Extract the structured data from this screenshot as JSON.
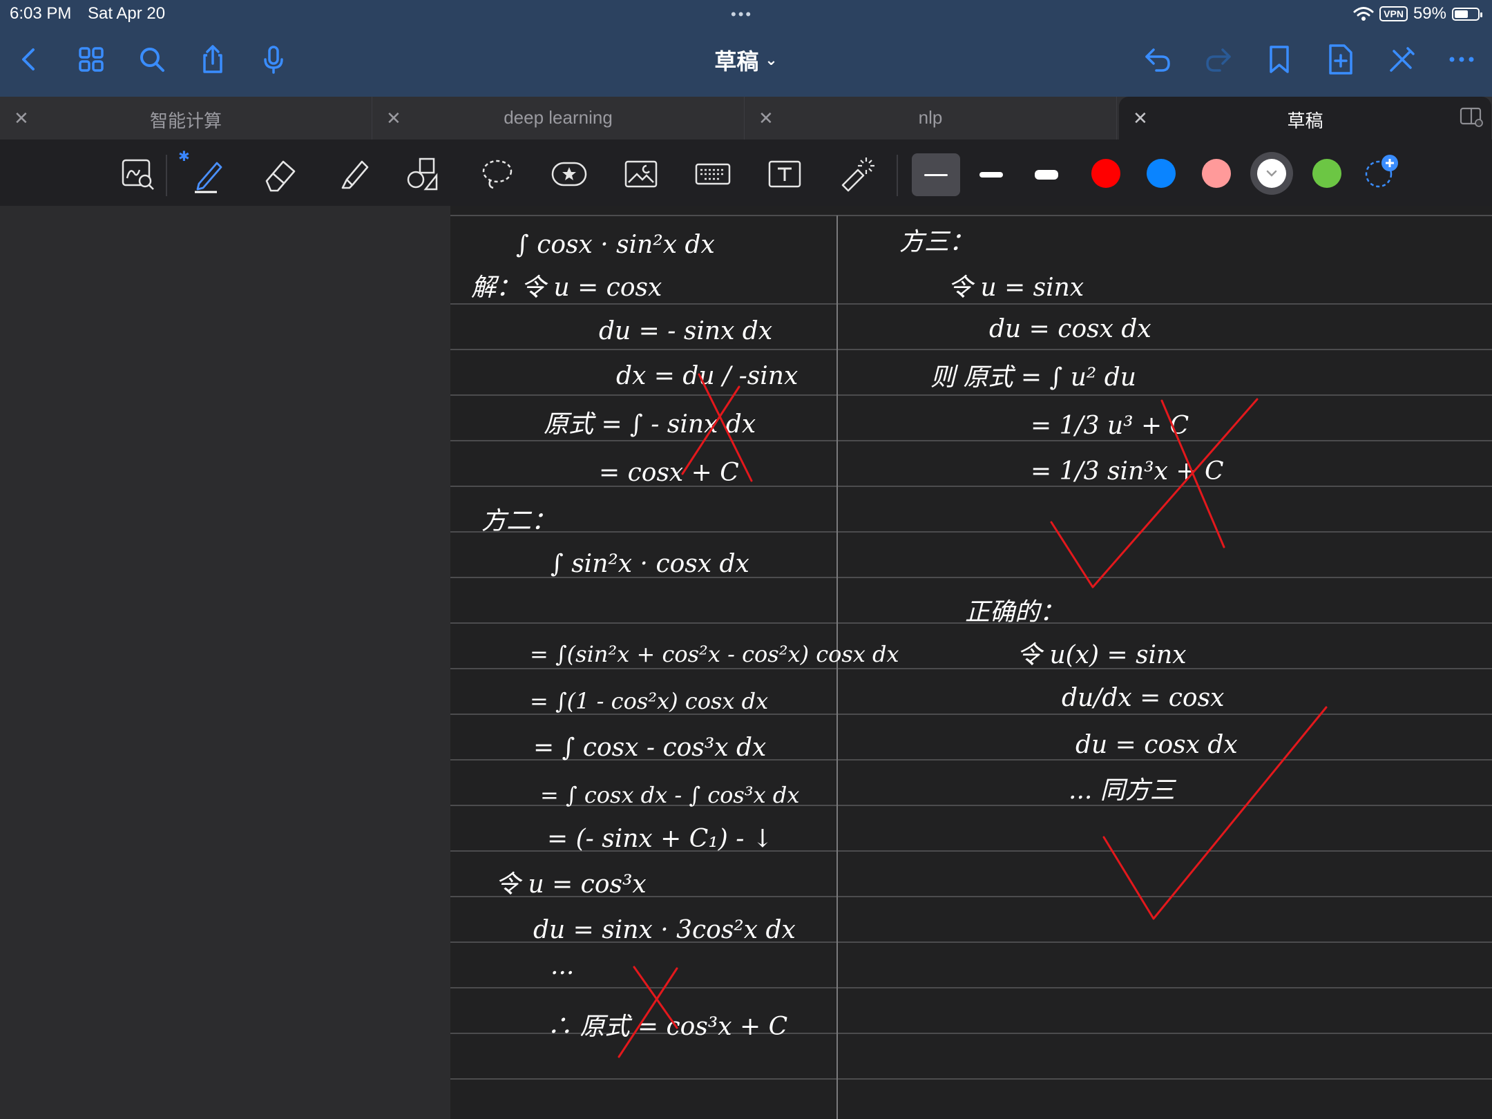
{
  "status_bar": {
    "time": "6:03 PM",
    "date": "Sat Apr 20",
    "vpn": "VPN",
    "battery_text": "59%",
    "battery_level": 0.59
  },
  "nav": {
    "title": "草稿",
    "title_chevron": "⌄"
  },
  "tabs": [
    {
      "label": "智能计算"
    },
    {
      "label": "deep learning"
    },
    {
      "label": "nlp"
    },
    {
      "label": "草稿",
      "active": true
    }
  ],
  "toolbar": {
    "colors": [
      "#ff0000",
      "#0a84ff",
      "#ff9a9a",
      "#ffffff",
      "#6cc644"
    ],
    "selected_color": "#ffffff",
    "pen_sizes": [
      "thin",
      "medium",
      "thick"
    ],
    "selected_pen_size": "thin"
  },
  "note": {
    "left_column": [
      "∫ cosx · sin²x dx",
      "解：令 u = cosx",
      "du = - sinx dx",
      "dx = du / -sinx",
      "原式 = ∫ - sinx dx",
      "= cosx + C",
      "方二：",
      "∫ sin²x · cosx dx",
      "= ∫(sin²x + cos²x - cos²x) cosx dx",
      "= ∫(1 - cos²x) cosx dx",
      "= ∫ cosx - cos³x dx",
      "= ∫ cosx dx - ∫ cos³x dx",
      "= (- sinx + C₁) - ↓",
      "令 u = cos³x",
      "du = sinx · 3cos²x dx",
      "...",
      "∴ 原式 = cos³x + C"
    ],
    "right_column": [
      "方三：",
      "令 u = sinx",
      "du = cosx dx",
      "则 原式 = ∫ u² du",
      "= 1/3 u³ + C",
      "= 1/3 sin³x + C",
      "正确的：",
      "令 u(x) = sinx",
      "du/dx = cosx",
      "du = cosx dx",
      "... 同方三"
    ]
  }
}
